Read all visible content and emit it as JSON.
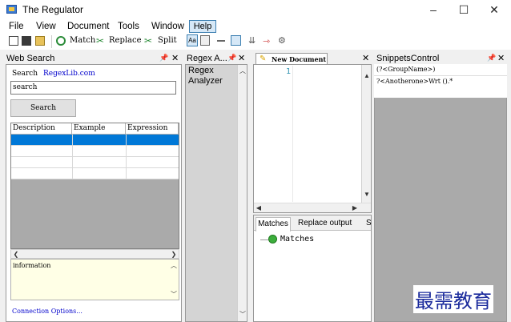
{
  "window": {
    "title": "The Regulator",
    "controls": [
      "–",
      "☐",
      "✕"
    ]
  },
  "menu": [
    "File",
    "View",
    "Document",
    "Tools",
    "Window",
    "Help"
  ],
  "toolbar": {
    "match": "Match",
    "replace": "Replace",
    "split": "Split"
  },
  "web_search": {
    "title": "Web Search",
    "search_label": "Search",
    "search_link": "RegexLib.com",
    "search_value": "search",
    "search_button": "Search",
    "columns": [
      "Description",
      "Example",
      "Expression"
    ],
    "info": "information",
    "connection_link": "Connection Options..."
  },
  "regex_analyzer": {
    "title": "Regex A...",
    "label": "Regex Analyzer"
  },
  "document": {
    "tab": "New Document",
    "line_number": "1"
  },
  "results": {
    "tabs": [
      "Matches",
      "Replace output",
      "S"
    ],
    "tree_root": "Matches"
  },
  "snippets": {
    "title": "SnippetsControl",
    "items": [
      "(?<GroupName>)",
      "?<Anotherone>Wrt ().*"
    ]
  },
  "watermark": "最需教育",
  "colors": {
    "selection": "#0078d7",
    "link": "#0000cc",
    "info_bg": "#ffffe6"
  }
}
